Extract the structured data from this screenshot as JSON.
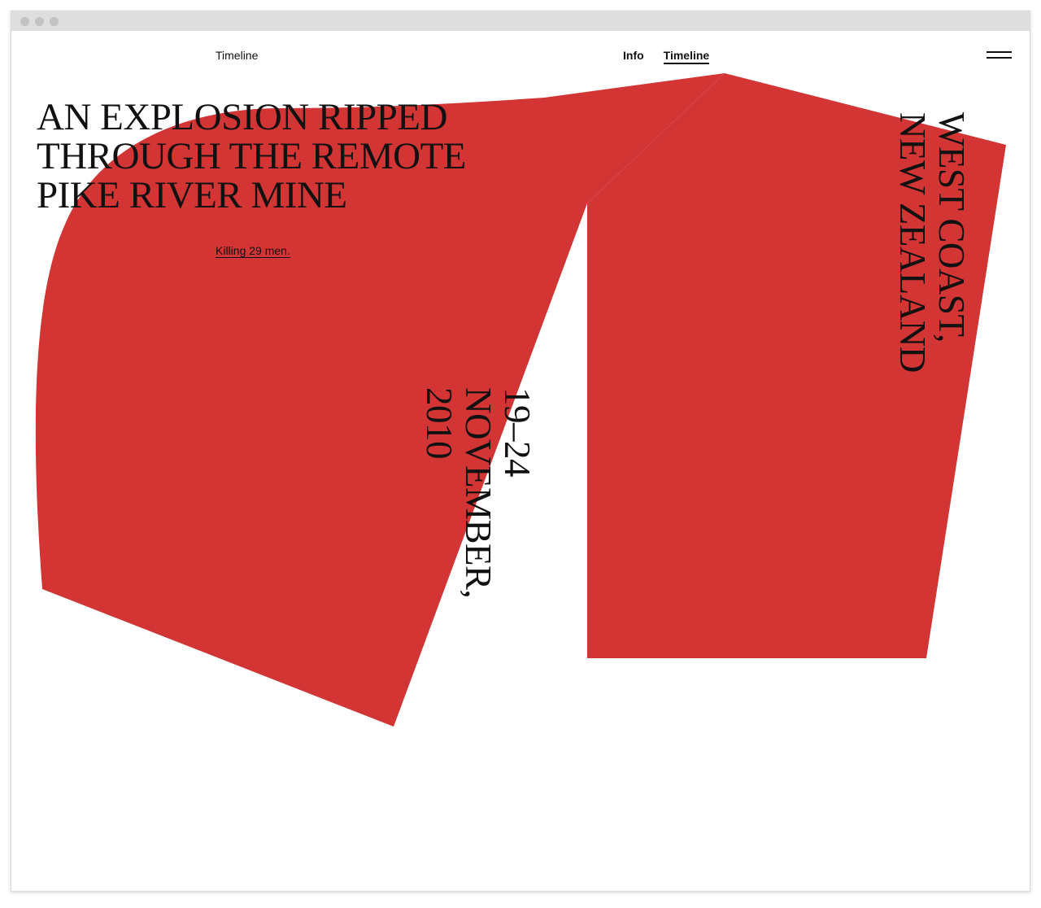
{
  "nav": {
    "left_link": "Timeline",
    "center_links": [
      "Info",
      "Timeline"
    ],
    "menu_icon": "hamburger-menu-icon"
  },
  "hero": {
    "headline_lines": [
      "AN EXPLOSION RIPPED",
      "THROUGH THE REMOTE",
      "PIKE RIVER MINE"
    ],
    "subline": "Killing 29 men.",
    "date_lines": [
      "19–24",
      "NOVEMBER,",
      "2010"
    ],
    "location_lines": [
      "WEST COAST,",
      "NEW ZEALAND"
    ]
  },
  "colors": {
    "accent_red": "#D33535",
    "text": "#111111",
    "background": "#FFFFFF"
  }
}
